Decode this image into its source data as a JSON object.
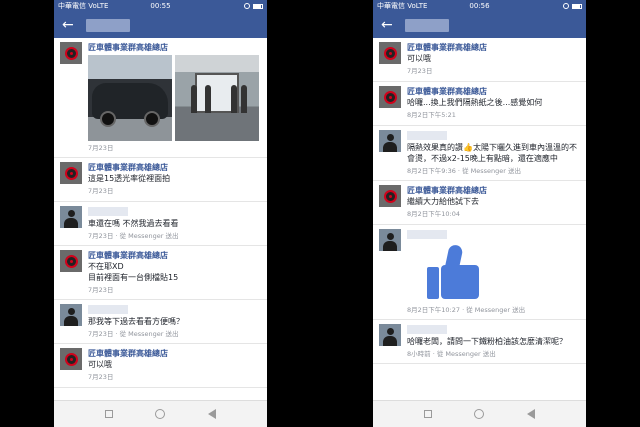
{
  "left": {
    "status": {
      "carrier": "中華電信 VoLTE",
      "time": "00:55",
      "battery_fill": 0.85
    },
    "messages": [
      {
        "type": "photos",
        "sender": "匠車體事業群高雄總店",
        "meta": "7月23日"
      },
      {
        "type": "text",
        "sender": "匠車體事業群高雄總店",
        "text": "這是15透光率從裡面拍",
        "meta": "7月23日"
      },
      {
        "type": "text",
        "sender": "",
        "text": "車還在嗎 不然我過去看看",
        "meta": "7月23日 · 從 Messenger 送出"
      },
      {
        "type": "text",
        "sender": "匠車體事業群高雄總店",
        "text": "不在耶XD\n目前裡面有一台側檔貼15",
        "meta": "7月23日"
      },
      {
        "type": "text",
        "sender": "",
        "text": "那我等下過去看看方便嗎？",
        "meta": "7月23日 · 從 Messenger 送出"
      },
      {
        "type": "text",
        "sender": "匠車體事業群高雄總店",
        "text": "可以哦",
        "meta": "7月23日"
      }
    ]
  },
  "right": {
    "status": {
      "carrier": "中華電信 VoLTE",
      "time": "00:56",
      "battery_fill": 0.85
    },
    "messages": [
      {
        "type": "text",
        "sender": "匠車體事業群高雄總店",
        "text": "可以哦",
        "meta": "7月23日"
      },
      {
        "type": "text",
        "sender": "匠車體事業群高雄總店",
        "text": "哈囉...換上我們隔熱紙之後...感覺如何",
        "meta": "8月2日下午5:21"
      },
      {
        "type": "text",
        "sender": "",
        "text": "隔熱效果真的讚👍太陽下曬久進到車內溫溫的不會燙，不過x2-15晚上有點暗，還在適應中",
        "meta": "8月2日下午9:36 · 從 Messenger 送出"
      },
      {
        "type": "text",
        "sender": "匠車體事業群高雄總店",
        "text": "繼續大力給他試下去",
        "meta": "8月2日下午10:04"
      },
      {
        "type": "like",
        "sender": "",
        "meta": "8月2日下午10:27 · 從 Messenger 送出"
      },
      {
        "type": "text",
        "sender": "",
        "text": "哈囉老闆，請問一下鐵粉柏油該怎麼清潔呢？",
        "meta": "8小時前 · 從 Messenger 送出"
      }
    ]
  },
  "icons": {
    "back": "←",
    "back_name": "back-arrow-icon"
  }
}
